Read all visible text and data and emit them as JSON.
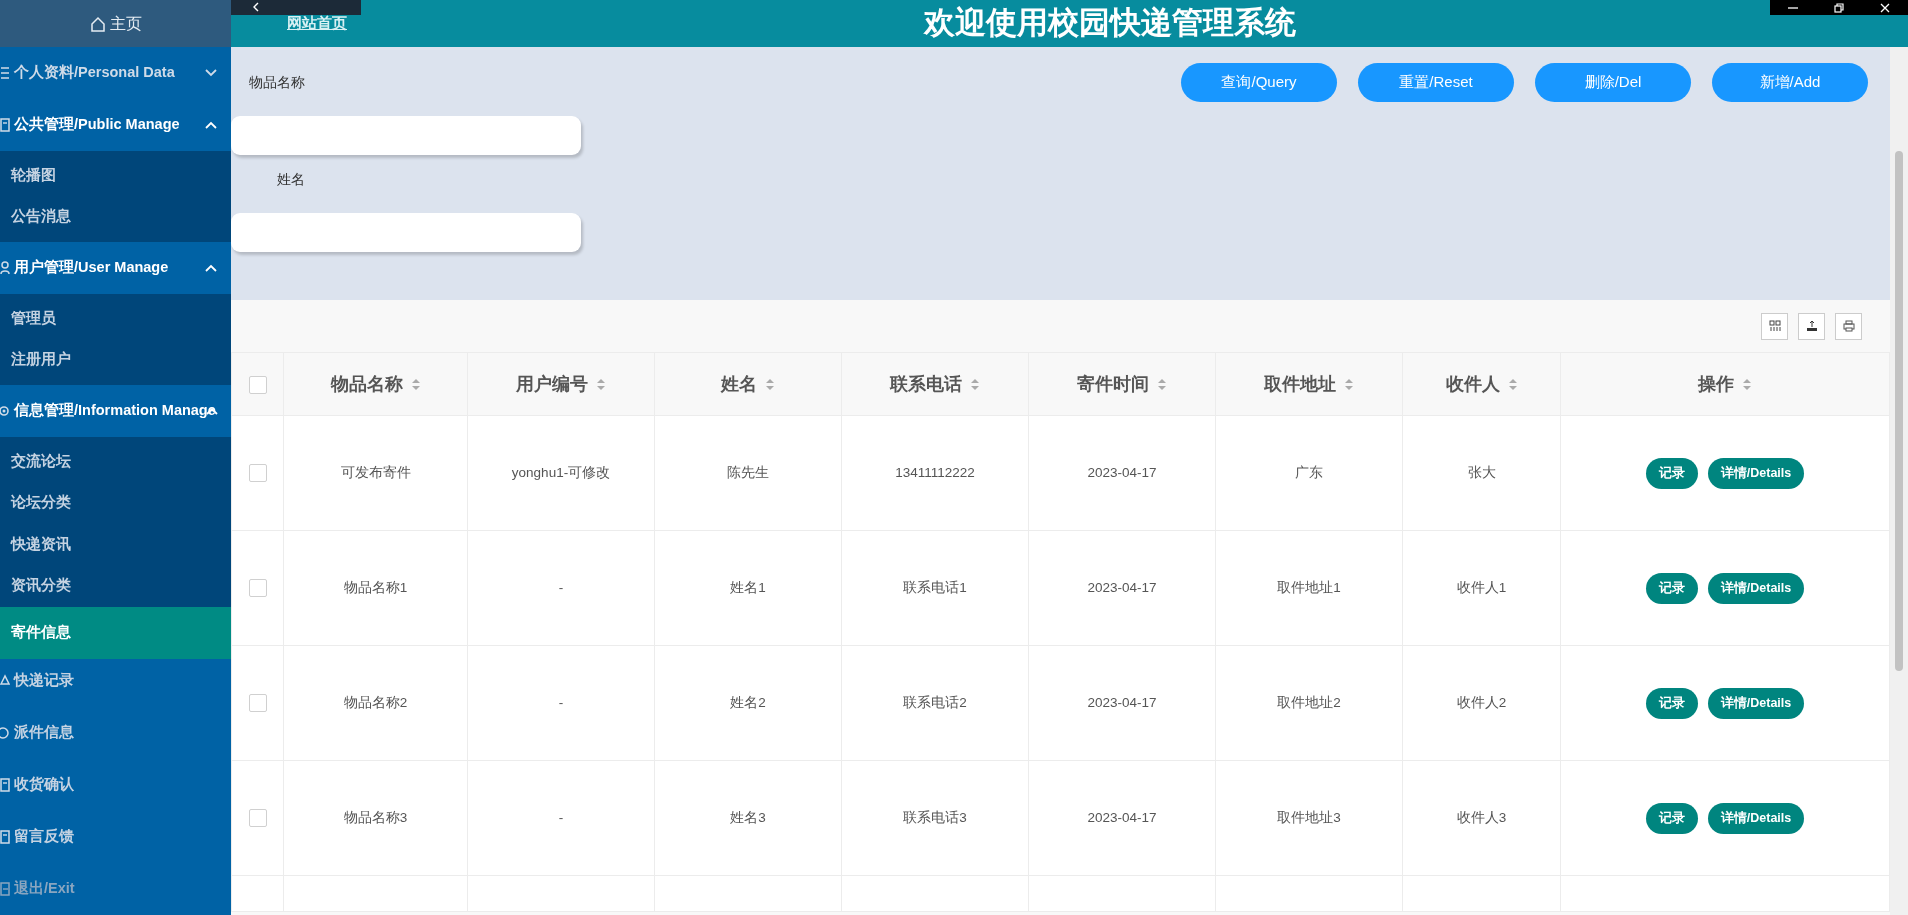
{
  "sidebar": {
    "home": "主页",
    "groups": [
      {
        "kind": "group",
        "label": "个人资料/Personal Data",
        "expanded": false
      },
      {
        "kind": "group",
        "label": "公共管理/Public Manage",
        "expanded": true,
        "children": [
          {
            "label": "轮播图",
            "selected": false
          },
          {
            "label": "公告消息",
            "selected": false
          }
        ]
      },
      {
        "kind": "group",
        "label": "用户管理/User Manage",
        "expanded": true,
        "children": [
          {
            "label": "管理员",
            "selected": false
          },
          {
            "label": "注册用户",
            "selected": false
          }
        ]
      },
      {
        "kind": "group",
        "label": "信息管理/Information Manage",
        "expanded": true,
        "children": [
          {
            "label": "交流论坛",
            "selected": false
          },
          {
            "label": "论坛分类",
            "selected": false
          },
          {
            "label": "快递资讯",
            "selected": false
          },
          {
            "label": "资讯分类",
            "selected": false
          },
          {
            "label": "寄件信息",
            "selected": true
          }
        ]
      },
      {
        "kind": "item",
        "label": "快递记录"
      },
      {
        "kind": "item",
        "label": "派件信息"
      },
      {
        "kind": "item",
        "label": "收货确认"
      },
      {
        "kind": "item",
        "label": "留言反馈"
      },
      {
        "kind": "exit",
        "label": "退出/Exit"
      }
    ]
  },
  "header": {
    "nav_link": "网站首页",
    "title": "欢迎使用校园快递管理系统"
  },
  "search": {
    "fields": [
      {
        "label": "物品名称"
      },
      {
        "label": "姓名"
      }
    ],
    "buttons": [
      "查询/Query",
      "重置/Reset",
      "删除/Del",
      "新增/Add"
    ]
  },
  "table": {
    "columns": [
      "物品名称",
      "用户编号",
      "姓名",
      "联系电话",
      "寄件时间",
      "取件地址",
      "收件人",
      "操作"
    ],
    "rows": [
      {
        "checked": false,
        "cells": [
          "可发布寄件",
          "yonghu1-可修改",
          "陈先生",
          "13411112222",
          "2023-04-17",
          "广东",
          "张大"
        ],
        "actions": [
          "记录",
          "详情/Details"
        ]
      },
      {
        "checked": false,
        "cells": [
          "物品名称1",
          "-",
          "姓名1",
          "联系电话1",
          "2023-04-17",
          "取件地址1",
          "收件人1"
        ],
        "actions": [
          "记录",
          "详情/Details"
        ]
      },
      {
        "checked": false,
        "cells": [
          "物品名称2",
          "-",
          "姓名2",
          "联系电话2",
          "2023-04-17",
          "取件地址2",
          "收件人2"
        ],
        "actions": [
          "记录",
          "详情/Details"
        ]
      },
      {
        "checked": false,
        "cells": [
          "物品名称3",
          "-",
          "姓名3",
          "联系电话3",
          "2023-04-17",
          "取件地址3",
          "收件人3"
        ],
        "actions": [
          "记录",
          "详情/Details"
        ]
      }
    ],
    "all_checked": false
  }
}
